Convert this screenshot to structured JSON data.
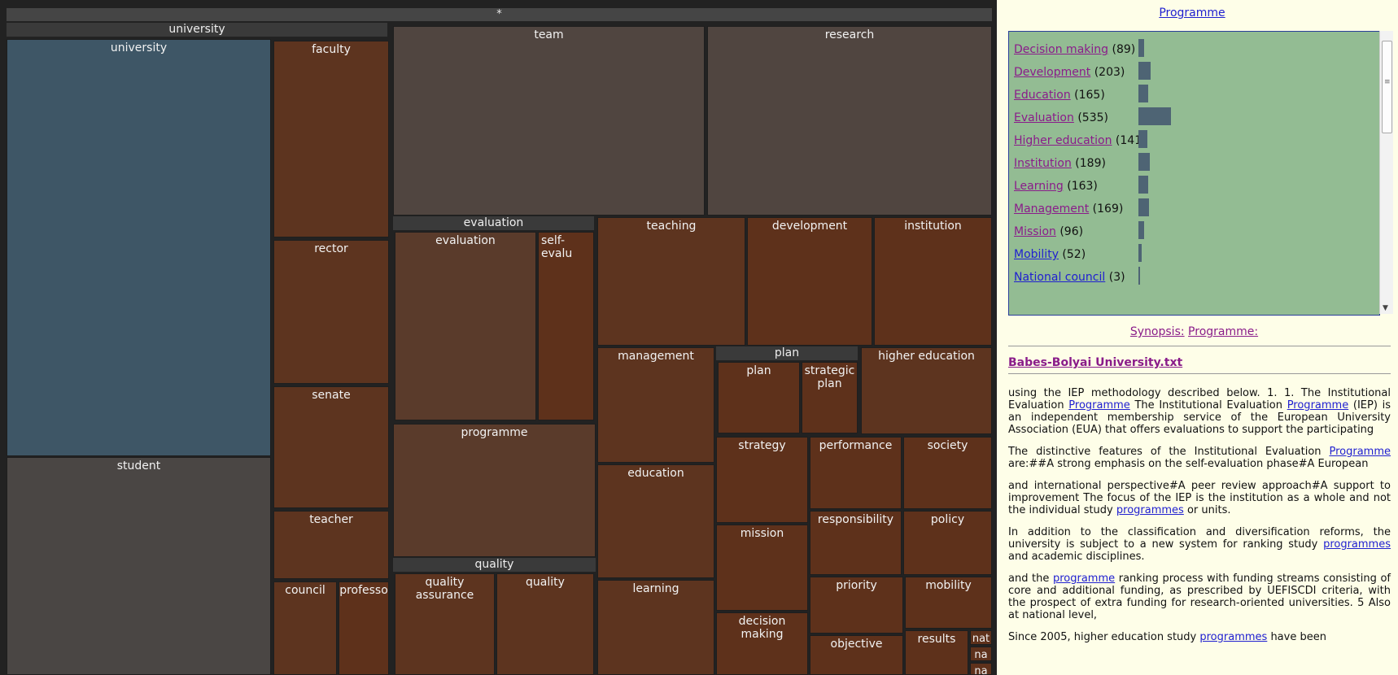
{
  "treemap": {
    "root_label": "*",
    "groups": {
      "university": "university",
      "evaluation": "evaluation",
      "quality": "quality",
      "plan": "plan"
    },
    "cells": {
      "university": "university",
      "student": "student",
      "faculty": "faculty",
      "rector": "rector",
      "senate": "senate",
      "teacher": "teacher",
      "council": "council",
      "professor": "professo",
      "team": "team",
      "research": "research",
      "evaluation": "evaluation",
      "self_evaluation": "self-evalu",
      "programme": "programme",
      "quality_assurance": "quality assurance",
      "quality": "quality",
      "teaching": "teaching",
      "development": "development",
      "institution": "institution",
      "management": "management",
      "education": "education",
      "learning": "learning",
      "plan": "plan",
      "strategic_plan": "strategic plan",
      "higher_education": "higher education",
      "strategy": "strategy",
      "performance": "performance",
      "society": "society",
      "mission": "mission",
      "responsibility": "responsibility",
      "policy": "policy",
      "decision_making": "decision making",
      "priority": "priority",
      "mobility": "mobility",
      "objective": "objective",
      "results": "results",
      "nat": "nat",
      "na1": "na",
      "na2": "na"
    }
  },
  "panel": {
    "title": "Programme",
    "facets": [
      {
        "label": "Decision making",
        "count": "(89)",
        "value": 89,
        "visited": true
      },
      {
        "label": "Development",
        "count": "(203)",
        "value": 203,
        "visited": true
      },
      {
        "label": "Education",
        "count": "(165)",
        "value": 165,
        "visited": true
      },
      {
        "label": "Evaluation",
        "count": "(535)",
        "value": 535,
        "visited": true
      },
      {
        "label": "Higher education",
        "count": "(141)",
        "value": 141,
        "visited": true
      },
      {
        "label": "Institution",
        "count": "(189)",
        "value": 189,
        "visited": true
      },
      {
        "label": "Learning",
        "count": "(163)",
        "value": 163,
        "visited": true
      },
      {
        "label": "Management",
        "count": "(169)",
        "value": 169,
        "visited": true
      },
      {
        "label": "Mission",
        "count": "(96)",
        "value": 96,
        "visited": true
      },
      {
        "label": "Mobility",
        "count": "(52)",
        "value": 52,
        "visited": false
      },
      {
        "label": "National council",
        "count": "(3)",
        "value": 3,
        "visited": false
      }
    ],
    "synopsis_label": "Synopsis:",
    "synopsis_value": "Programme:",
    "doc_title": "Babes-Bolyai University.txt",
    "paragraphs": [
      [
        "using the IEP methodology described below. 1. 1. The Institutional Evaluation ",
        {
          "link": "Programme"
        },
        " The Institutional Evaluation ",
        {
          "link": "Programme"
        },
        " (IEP) is an independent membership service of the European University Association (EUA) that offers evaluations to support the participating"
      ],
      [
        "The distinctive features of the Institutional Evaluation ",
        {
          "link": "Programme"
        },
        " are:##A strong emphasis on the self-evaluation phase#A European"
      ],
      [
        "and international perspective#A peer review approach#A support to improvement The focus of the IEP is the institution as a whole and not the individual study ",
        {
          "link": "programmes"
        },
        " or units."
      ],
      [
        "In addition to the classification and diversification reforms, the university is subject to a new system for ranking study ",
        {
          "link": "programmes"
        },
        " and academic disciplines."
      ],
      [
        "and the ",
        {
          "link": "programme"
        },
        " ranking process with funding streams consisting of core and additional funding, as prescribed by UEFISCDI criteria, with the prospect of extra funding for research-oriented universities. 5 Also at national level,"
      ],
      [
        "Since 2005, higher education study ",
        {
          "link": "programmes"
        },
        " have been"
      ]
    ]
  }
}
